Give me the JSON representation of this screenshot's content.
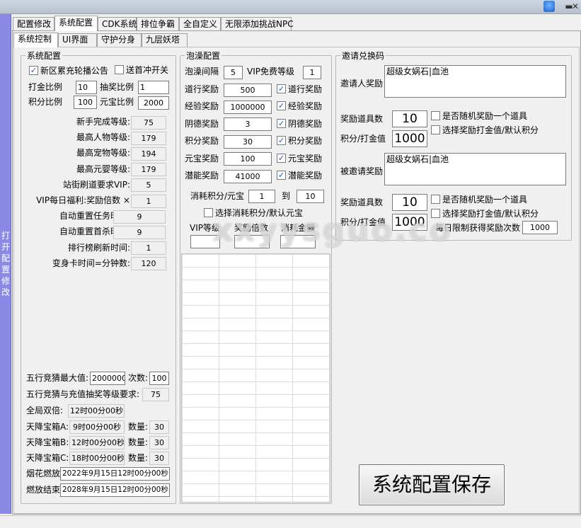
{
  "window": {
    "min_glyph": "▬",
    "close_glyph": "✕"
  },
  "sidebar": {
    "label": "打开配置修改"
  },
  "tabs": [
    "配置修改",
    "系统配置",
    "CDK系统",
    "排位争霸",
    "全自定义",
    "无限添加挑战NPC"
  ],
  "subtabs": [
    "系统控制",
    "UI界面",
    "守护分身",
    "九层妖塔"
  ],
  "sys": {
    "legend": "系统配置",
    "cb_announce": "新区累充轮播公告",
    "cb_first_recharge": "送首冲开关",
    "gold_ratio_label": "打金比例",
    "gold_ratio": "10",
    "lottery_ratio_label": "抽奖比例",
    "lottery_ratio": "1",
    "points_ratio_label": "积分比例",
    "points_ratio": "100",
    "yuanbao_ratio_label": "元宝比例",
    "yuanbao_ratio": "2000",
    "rows": [
      {
        "label": "新手完成等级:",
        "value": "75"
      },
      {
        "label": "最高人物等级:",
        "value": "179"
      },
      {
        "label": "最高宠物等级:",
        "value": "194"
      },
      {
        "label": "最高元婴等级:",
        "value": "179"
      },
      {
        "label": "站街刷道要求VIP:",
        "value": "5"
      },
      {
        "label": "VIP每日福利:奖励倍数  ×",
        "value": "1"
      },
      {
        "label": "自动重置任务时间:",
        "value": "9"
      },
      {
        "label": "自动重置首杀时间:",
        "value": "9"
      },
      {
        "label": "排行榜刷新时间:",
        "value": "1"
      },
      {
        "label": "变身卡时间=分钟数:",
        "value": "120"
      }
    ],
    "wuxing_max_label": "五行竞猜最大值:",
    "wuxing_max": "20000000",
    "count_label": "次数:",
    "count": "100",
    "wuxing_level_label": "五行竞猜与充值抽奖等级要求:",
    "wuxing_level": "75",
    "double_label": "全局双倍:",
    "double_time": "12时00分00秒",
    "chests": [
      {
        "label": "天降宝箱A:",
        "time": "9时00分00秒",
        "qty_label": "数量:",
        "qty": "30"
      },
      {
        "label": "天降宝箱B:",
        "time": "12时00分00秒",
        "qty_label": "数量:",
        "qty": "30"
      },
      {
        "label": "天降宝箱C:",
        "time": "18时00分00秒",
        "qty_label": "数量:",
        "qty": "30"
      }
    ],
    "fireworks_label": "烟花燃放",
    "fireworks_time": "2022年9月15日12时00分00秒",
    "fireworks_end_label": "燃放结束",
    "fireworks_end_time": "2028年9月15日12时00分00秒"
  },
  "bath": {
    "legend": "泡澡配置",
    "interval_label": "泡澡间隔",
    "interval": "5",
    "vip_free_label": "VIP免费等级",
    "vip_free": "1",
    "rows": [
      {
        "label": "道行奖励",
        "value": "500",
        "cb": "道行奖励"
      },
      {
        "label": "经验奖励",
        "value": "1000000",
        "cb": "经验奖励"
      },
      {
        "label": "阴德奖励",
        "value": "3",
        "cb": "阴德奖励"
      },
      {
        "label": "积分奖励",
        "value": "30",
        "cb": "积分奖励"
      },
      {
        "label": "元宝奖励",
        "value": "100",
        "cb": "元宝奖励"
      },
      {
        "label": "潜能奖励",
        "value": "41000",
        "cb": "潜能奖励"
      }
    ],
    "consume_label": "消耗积分/元宝",
    "consume_from": "1",
    "to_label": "到",
    "consume_to": "10",
    "cb_consume": "选择消耗积分/默认元宝",
    "col_vip": "VIP等级",
    "col_reward": "奖励倍数",
    "col_amount": "消耗金额"
  },
  "invite": {
    "legend": "邀请兑换码",
    "inviter_label": "邀请人奖励",
    "inviter_text": "超级女娲石|血池",
    "item_count_label": "奖励道具数",
    "item_count": "10",
    "cb_random": "是否随机奖励一个道具",
    "cb_gold_points": "选择奖励打金值/默认积分",
    "points_label": "积分/打金值",
    "points": "1000",
    "invitee_label": "被邀请奖励",
    "invitee_text": "超级女娲石|血池",
    "item_count2": "10",
    "points2": "1000",
    "daily_limit_label": "每日限制获得奖励次数",
    "daily_limit": "1000"
  },
  "save_label": "系统配置保存",
  "watermark": "xxyysguo.co"
}
